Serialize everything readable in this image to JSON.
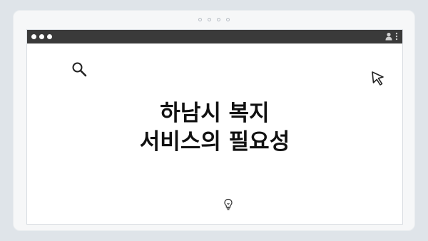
{
  "headline": {
    "line1": "하남시 복지",
    "line2": "서비스의 필요성"
  },
  "icons": {
    "search": "search-icon",
    "cursor": "cursor-arrow-icon",
    "idea": "lightbulb-icon",
    "user": "user-icon",
    "menu": "kebab-menu-icon"
  },
  "colors": {
    "titlebar": "#3a3a3a",
    "page_background": "#dfe4e9",
    "card_background": "#f6f7f8",
    "window_background": "#ffffff",
    "text": "#111111"
  }
}
